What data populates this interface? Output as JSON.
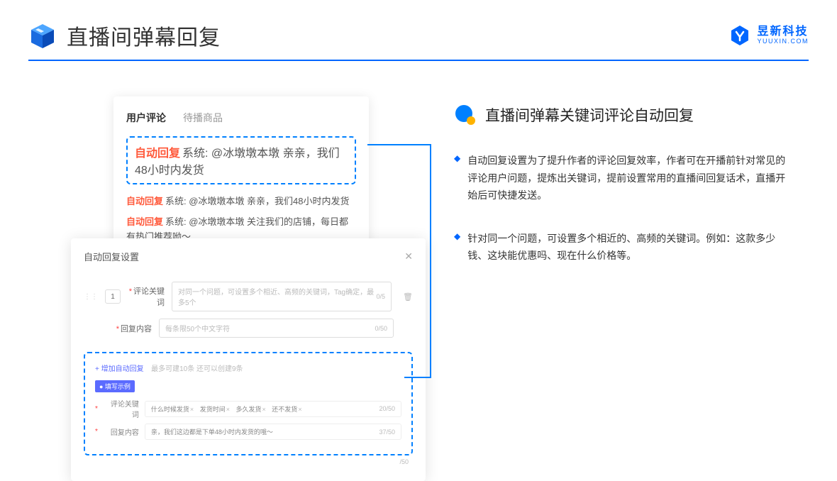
{
  "header": {
    "title": "直播间弹幕回复",
    "logo_main": "昱新科技",
    "logo_sub": "YUUXIN.COM"
  },
  "comment_card": {
    "tabs": {
      "active": "用户评论",
      "inactive": "待播商品"
    },
    "rows": [
      {
        "badge": "自动回复",
        "text": "系统: @冰墩墩本墩 亲亲，我们48小时内发货"
      },
      {
        "badge": "自动回复",
        "text": "系统: @冰墩墩本墩 亲亲，我们48小时内发货"
      },
      {
        "badge": "自动回复",
        "text": "系统: @冰墩墩本墩 关注我们的店铺，每日都有热门推荐呦～"
      }
    ]
  },
  "settings": {
    "title": "自动回复设置",
    "num": "1",
    "keyword_label": "评论关键词",
    "keyword_placeholder": "对同一个问题，可设置多个相近、高频的关键词，Tag确定，最多5个",
    "keyword_counter": "0/5",
    "content_label": "回复内容",
    "content_placeholder": "每条限50个中文字符",
    "content_counter": "0/50",
    "add_link": "+ 增加自动回复",
    "add_hint": "最多可建10条 还可以创建9条",
    "example_badge": "● 填写示例",
    "ex_keyword_label": "评论关键词",
    "ex_tags": [
      "什么时候发货",
      "发货时间",
      "多久发货",
      "还不发货"
    ],
    "ex_keyword_counter": "20/50",
    "ex_content_label": "回复内容",
    "ex_content_value": "亲，我们这边都是下单48小时内发货的哦～",
    "ex_content_counter": "37/50",
    "outer_counter": "/50"
  },
  "right": {
    "title": "直播间弹幕关键词评论自动回复",
    "bullets": [
      "自动回复设置为了提升作者的评论回复效率，作者可在开播前针对常见的评论用户问题，提炼出关键词，提前设置常用的直播间回复话术，直播开始后可快捷发送。",
      "针对同一个问题，可设置多个相近的、高频的关键词。例如：这款多少钱、这块能优惠吗、现在什么价格等。"
    ]
  }
}
